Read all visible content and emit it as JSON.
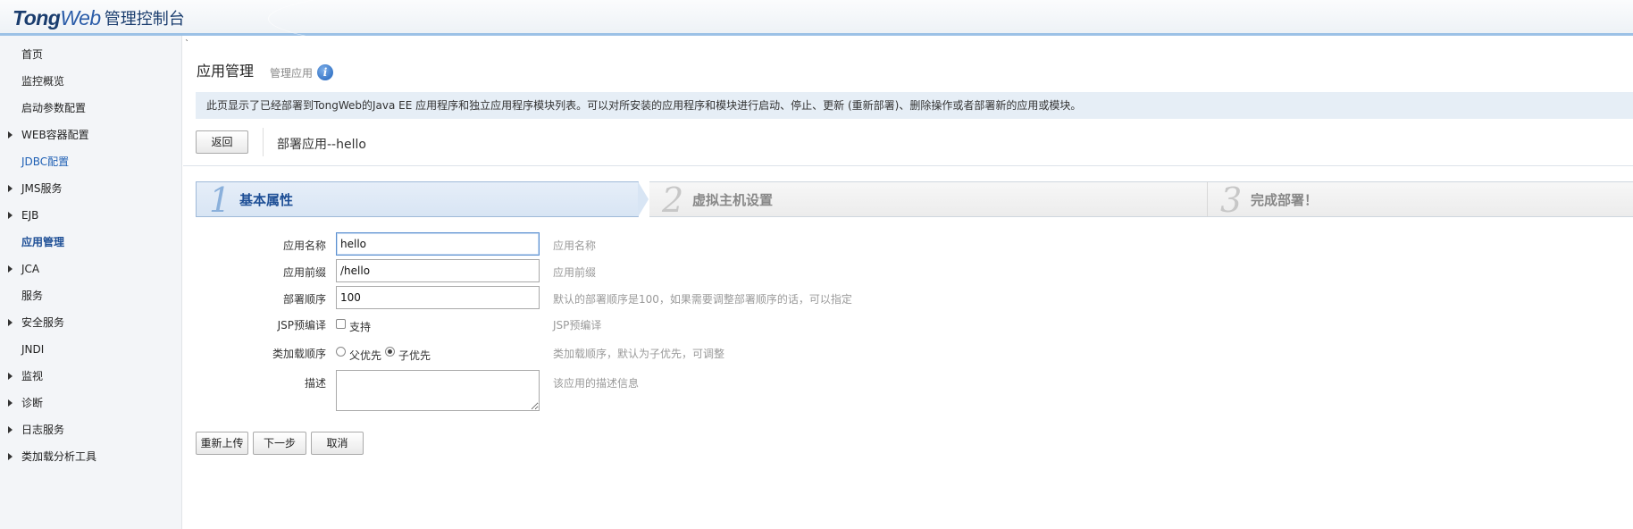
{
  "header": {
    "brand_tong": "Tong",
    "brand_web": "Web",
    "suffix": "管理控制台"
  },
  "sidebar": {
    "items": [
      {
        "label": "首页",
        "expandable": false
      },
      {
        "label": "监控概览",
        "expandable": false
      },
      {
        "label": "启动参数配置",
        "expandable": false
      },
      {
        "label": "WEB容器配置",
        "expandable": true
      },
      {
        "label": "JDBC配置",
        "expandable": false,
        "state": "hover"
      },
      {
        "label": "JMS服务",
        "expandable": true
      },
      {
        "label": "EJB",
        "expandable": true
      },
      {
        "label": "应用管理",
        "expandable": false,
        "state": "active"
      },
      {
        "label": "JCA",
        "expandable": true
      },
      {
        "label": "服务",
        "expandable": false
      },
      {
        "label": "安全服务",
        "expandable": true
      },
      {
        "label": "JNDI",
        "expandable": false
      },
      {
        "label": "监视",
        "expandable": true
      },
      {
        "label": "诊断",
        "expandable": true
      },
      {
        "label": "日志服务",
        "expandable": true
      },
      {
        "label": "类加载分析工具",
        "expandable": true
      }
    ]
  },
  "main": {
    "tick": "`",
    "title": "应用管理",
    "subtitle": "管理应用",
    "info_icon": "i",
    "description": "此页显示了已经部署到TongWeb的Java EE 应用程序和独立应用程序模块列表。可以对所安装的应用程序和模块进行启动、停止、更新 (重新部署)、删除操作或者部署新的应用或模块。",
    "back_label": "返回",
    "deploy_title": "部署应用--hello"
  },
  "wizard": {
    "steps": [
      {
        "num": "1",
        "label": "基本属性",
        "active": true
      },
      {
        "num": "2",
        "label": "虚拟主机设置",
        "active": false
      },
      {
        "num": "3",
        "label": "完成部署！",
        "active": false
      }
    ]
  },
  "form": {
    "app_name_label": "应用名称",
    "app_name_value": "hello",
    "app_name_hint": "应用名称",
    "prefix_label": "应用前缀",
    "prefix_value": "/hello",
    "prefix_hint": "应用前缀",
    "order_label": "部署顺序",
    "order_value": "100",
    "order_hint": "默认的部署顺序是100，如果需要调整部署顺序的话，可以指定",
    "jsp_label": "JSP预编译",
    "jsp_option": "支持",
    "jsp_checked": false,
    "jsp_hint": "JSP预编译",
    "loader_label": "类加载顺序",
    "loader_parent": "父优先",
    "loader_child": "子优先",
    "loader_selected": "子优先",
    "loader_hint": "类加载顺序，默认为子优先，可调整",
    "desc_label": "描述",
    "desc_value": "",
    "desc_hint": "该应用的描述信息"
  },
  "actions": {
    "reupload": "重新上传",
    "next": "下一步",
    "cancel": "取消"
  }
}
